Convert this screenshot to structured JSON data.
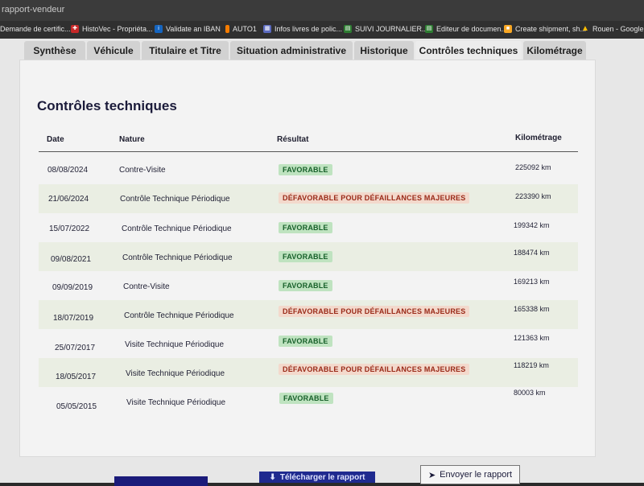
{
  "browser": {
    "window_title": "rapport-vendeur"
  },
  "bookmarks": [
    {
      "label": "Demande de certific...",
      "icon": "page-icon",
      "color": "#444444"
    },
    {
      "label": "HistoVec - Propriéta...",
      "icon": "histovec-icon",
      "color": "#c62828"
    },
    {
      "label": "Validate an IBAN",
      "icon": "iban-icon",
      "color": "#1565c0"
    },
    {
      "label": "AUTO1",
      "icon": "auto1-icon",
      "color": "#f57c00"
    },
    {
      "label": "Infos livres de polic...",
      "icon": "grid-icon",
      "color": "#5c6bc0"
    },
    {
      "label": "SUIVI JOURNALIER...",
      "icon": "sheet-icon",
      "color": "#2e7d32"
    },
    {
      "label": "Editeur de documen...",
      "icon": "doc-icon",
      "color": "#2e7d32"
    },
    {
      "label": "Create shipment, sh...",
      "icon": "shipment-icon",
      "color": "#f9a825"
    },
    {
      "label": "Rouen - Google Driv",
      "icon": "drive-icon",
      "color": "#fbbc04"
    }
  ],
  "tabs": [
    "Synthèse",
    "Véhicule",
    "Titulaire et Titre",
    "Situation administrative",
    "Historique",
    "Contrôles techniques",
    "Kilométrage"
  ],
  "active_tab": "Contrôles techniques",
  "section": {
    "title": "Contrôles techniques",
    "columns": {
      "date": "Date",
      "nature": "Nature",
      "result": "Résultat",
      "km": "Kilométrage"
    }
  },
  "rows": [
    {
      "date": "08/08/2024",
      "nature": "Contre-Visite",
      "result": "FAVORABLE",
      "status": "ok",
      "km": "225092 km"
    },
    {
      "date": "21/06/2024",
      "nature": "Contrôle Technique Périodique",
      "result": "DÉFAVORABLE POUR DÉFAILLANCES MAJEURES",
      "status": "ko",
      "km": "223390 km"
    },
    {
      "date": "15/07/2022",
      "nature": "Contrôle Technique Périodique",
      "result": "FAVORABLE",
      "status": "ok",
      "km": "199342 km"
    },
    {
      "date": "09/08/2021",
      "nature": "Contrôle Technique Périodique",
      "result": "FAVORABLE",
      "status": "ok",
      "km": "188474 km"
    },
    {
      "date": "09/09/2019",
      "nature": "Contre-Visite",
      "result": "FAVORABLE",
      "status": "ok",
      "km": "169213 km"
    },
    {
      "date": "18/07/2019",
      "nature": "Contrôle Technique Périodique",
      "result": "DÉFAVORABLE POUR DÉFAILLANCES MAJEURES",
      "status": "ko",
      "km": "165338 km"
    },
    {
      "date": "25/07/2017",
      "nature": "Visite Technique Périodique",
      "result": "FAVORABLE",
      "status": "ok",
      "km": "121363 km"
    },
    {
      "date": "18/05/2017",
      "nature": "Visite Technique Périodique",
      "result": "DÉFAVORABLE POUR DÉFAILLANCES MAJEURES",
      "status": "ko",
      "km": "118219 km"
    },
    {
      "date": "05/05/2015",
      "nature": "Visite Technique Périodique",
      "result": "FAVORABLE",
      "status": "ok",
      "km": "80003 km"
    }
  ],
  "actions": {
    "download": "Télécharger le rapport",
    "send": "Envoyer le rapport"
  }
}
